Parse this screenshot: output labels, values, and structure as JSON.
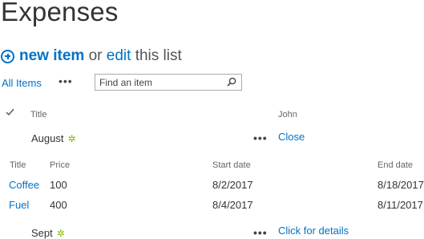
{
  "page": {
    "title": "Expenses"
  },
  "commands": {
    "new_item": "new item",
    "or": "or",
    "edit": "edit",
    "this_list": "this list"
  },
  "views": {
    "current": "All Items",
    "more": "•••"
  },
  "search": {
    "placeholder": "Find an item"
  },
  "list_header": {
    "title": "Title",
    "john": "John"
  },
  "groups": [
    {
      "label": "August",
      "more": "•••",
      "link": "Close"
    },
    {
      "label": "Sept",
      "more": "•••",
      "link": "Click for details"
    }
  ],
  "sub_table": {
    "headers": {
      "title": "Title",
      "price": "Price",
      "start": "Start date",
      "end": "End date"
    },
    "rows": [
      {
        "title": "Coffee",
        "price": "100",
        "start": "8/2/2017",
        "end": "8/18/2017"
      },
      {
        "title": "Fuel",
        "price": "400",
        "start": "8/4/2017",
        "end": "8/11/2017"
      }
    ]
  },
  "colors": {
    "accent": "#0072c6",
    "new_marker": "#7fba00",
    "text": "#333333"
  },
  "icons": {
    "add": "plus-circle-icon",
    "search": "search-icon",
    "check": "checkmark-icon",
    "new": "new-item-icon"
  }
}
